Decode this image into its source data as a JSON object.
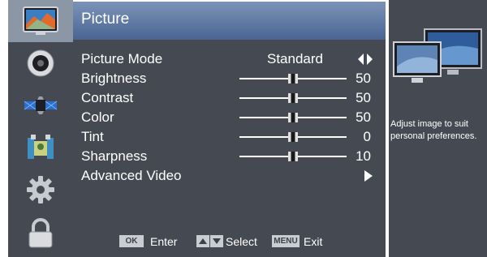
{
  "menu": {
    "title": "Picture",
    "categories": [
      {
        "icon": "picture-icon",
        "active": true
      },
      {
        "icon": "audio-speaker-icon",
        "active": false
      },
      {
        "icon": "channel-satellite-icon",
        "active": false
      },
      {
        "icon": "parental-lock-icon",
        "active": false
      },
      {
        "icon": "setup-gear-icon",
        "active": false
      },
      {
        "icon": "lock-icon",
        "active": false
      }
    ],
    "items": {
      "picture_mode": {
        "label": "Picture Mode",
        "value": "Standard"
      },
      "brightness": {
        "label": "Brightness",
        "value": "50",
        "level": 50,
        "max": 100
      },
      "contrast": {
        "label": "Contrast",
        "value": "50",
        "level": 50,
        "max": 100
      },
      "color": {
        "label": "Color",
        "value": "50",
        "level": 50,
        "max": 100
      },
      "tint": {
        "label": "Tint",
        "value": "0",
        "level": 0,
        "min": -50,
        "max": 50
      },
      "sharpness": {
        "label": "Sharpness",
        "value": "10",
        "level": 10,
        "max": 20
      },
      "advanced_video": {
        "label": "Advanced Video"
      }
    }
  },
  "footer": {
    "ok_key": "OK",
    "ok_label": "Enter",
    "select_label": "Select",
    "menu_key": "MENU",
    "menu_label": "Exit"
  },
  "info": {
    "description": "Adjust image to suit personal preferences."
  },
  "colors": {
    "panel": "#454a52",
    "header_top": "#7c93b8",
    "header_bottom": "#4a6593",
    "active_icon_bg": "#8c97a5",
    "text": "#ffffff"
  }
}
